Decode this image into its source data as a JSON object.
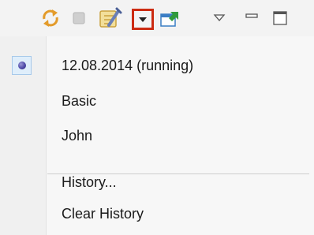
{
  "toolbar": {
    "buttons": [
      {
        "icon": "sync-arrows-icon",
        "enabled": true
      },
      {
        "icon": "stop-icon",
        "enabled": false
      },
      {
        "icon": "launch-history-icon",
        "enabled": true
      },
      {
        "icon": "dropdown-arrow-icon",
        "highlighted": true
      },
      {
        "icon": "open-console-icon",
        "enabled": true
      },
      {
        "icon": "view-menu-icon",
        "enabled": true
      },
      {
        "icon": "minimize-icon",
        "enabled": true
      },
      {
        "icon": "maximize-icon",
        "enabled": true
      }
    ],
    "highlight_color": "#cc2b12"
  },
  "menu": {
    "items": [
      {
        "label": "12.08.2014 (running)",
        "selected": true
      },
      {
        "label": "Basic",
        "selected": false
      },
      {
        "label": "John",
        "selected": false
      }
    ],
    "actions": [
      {
        "label": "History..."
      },
      {
        "label": "Clear History"
      }
    ]
  }
}
